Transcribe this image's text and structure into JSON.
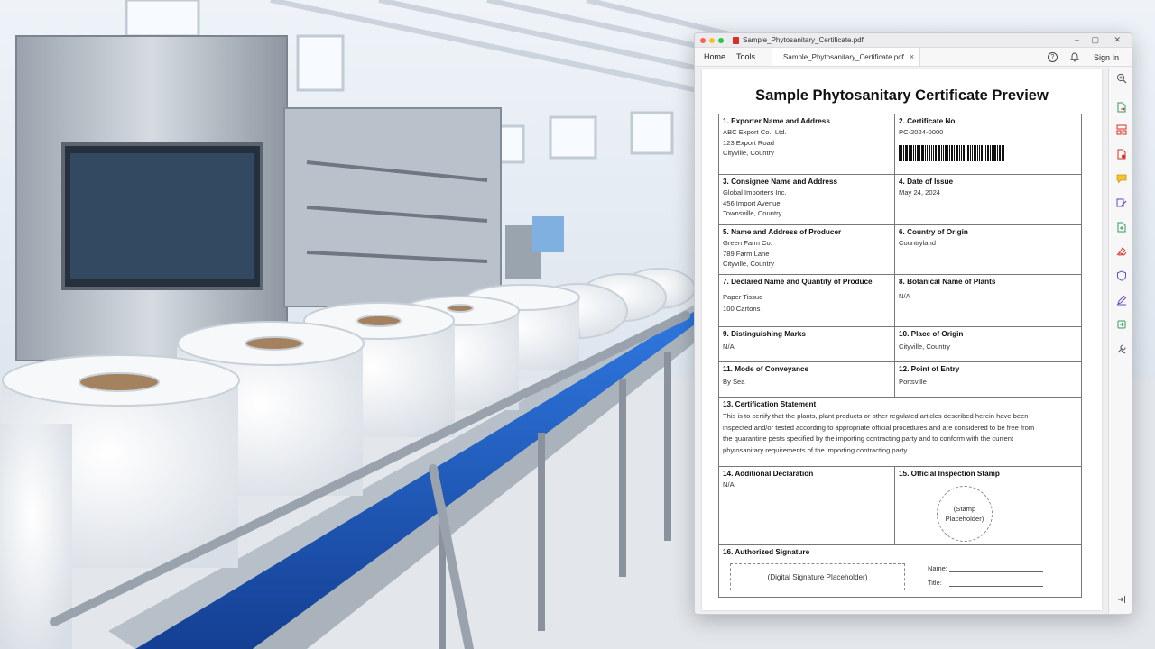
{
  "window": {
    "title": "Sample_Phytosanitary_Certificate.pdf",
    "controls": {
      "minimize": "–",
      "maximize": "▢",
      "close": "✕"
    }
  },
  "toolbar": {
    "home": "Home",
    "tools": "Tools",
    "tab_label": "Sample_Phytosanitary_Certificate.pdf",
    "tab_close": "×",
    "help": "?",
    "signin": "Sign In"
  },
  "certificate": {
    "title": "Sample Phytosanitary Certificate Preview",
    "exporter": {
      "label": "1. Exporter Name and Address",
      "lines": [
        "ABC Export Co., Ltd.",
        "123 Export Road",
        "Cityville, Country"
      ]
    },
    "certificate_no": {
      "label": "2. Certificate No.",
      "value": "PC-2024-0000"
    },
    "consignee": {
      "label": "3. Consignee Name and Address",
      "lines": [
        "Global Importers Inc.",
        "456 Import Avenue",
        "Townsville, Country"
      ]
    },
    "date_of_issue": {
      "label": "4. Date of Issue",
      "value": "May 24, 2024"
    },
    "producer": {
      "label": "5. Name and Address of Producer",
      "lines": [
        "Green Farm Co.",
        "789 Farm Lane",
        "Cityville, Country"
      ]
    },
    "country_of_origin": {
      "label": "6. Country of Origin",
      "value": "Countryland"
    },
    "produce": {
      "label": "7. Declared Name and Quantity of Produce",
      "lines": [
        "Paper Tissue",
        "100 Cartons"
      ]
    },
    "botanical_name": {
      "label": "8. Botanical Name of Plants",
      "value": "N/A"
    },
    "marks": {
      "label": "9. Distinguishing Marks",
      "value": "N/A"
    },
    "place_of_origin": {
      "label": "10. Place of Origin",
      "value": "Cityville, Country"
    },
    "conveyance": {
      "label": "11. Mode of Conveyance",
      "value": "By Sea"
    },
    "point_of_entry": {
      "label": "12. Point of Entry",
      "value": "Portsville"
    },
    "statement": {
      "label": "13. Certification Statement",
      "lines": [
        "This is to certify that the plants, plant products or other regulated articles described herein have been",
        "inspected and/or tested according to appropriate official procedures and are considered to be free from",
        "the quarantine pests specified by the importing contracting party and to conform with the current",
        "phytosanitary requirements of the importing contracting party."
      ]
    },
    "additional": {
      "label": "14. Additional Declaration",
      "value": "N/A"
    },
    "stamp": {
      "label": "15. Official Inspection Stamp",
      "lines": [
        "(Stamp",
        "Placeholder)"
      ]
    },
    "signature": {
      "label": "16. Authorized Signature",
      "placeholder": "(Digital Signature Placeholder)",
      "name_label": "Name:",
      "title_label": "Title:"
    }
  },
  "rail_icons": [
    "zoom-icon",
    "export-pdf-icon",
    "organize-pages-icon",
    "edit-pdf-icon",
    "comment-icon",
    "request-signature-icon",
    "create-pdf-icon",
    "fill-sign-icon",
    "protect-icon",
    "markup-icon",
    "compress-icon",
    "more-tools-icon",
    "collapse-panel-icon"
  ],
  "colors": {
    "accent_red": "#d93025",
    "rail_green": "#2e9d5b",
    "rail_purple": "#6a45c9",
    "conveyor_blue": "#1f5fc9"
  }
}
